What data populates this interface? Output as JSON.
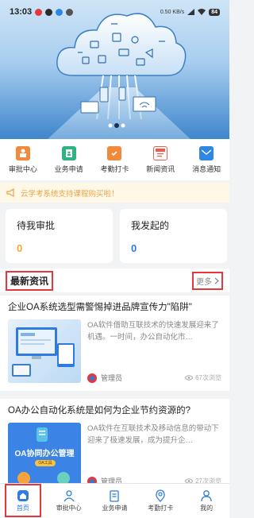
{
  "status_bar": {
    "time": "13:03",
    "network": "0.50 KB/s",
    "battery": "84"
  },
  "colors": {
    "accent": "#2f7be0",
    "highlight": "#e8373a",
    "notice": "#e7a64a",
    "count": "#f0a93a",
    "count2": "#2f7be0"
  },
  "quick_menu": [
    {
      "label": "审批中心",
      "icon": "stamp-icon",
      "color": "#f08a3c"
    },
    {
      "label": "业务申请",
      "icon": "clipboard-icon",
      "color": "#2fb383"
    },
    {
      "label": "考勤打卡",
      "icon": "calendar-check-icon",
      "color": "#f28a3c"
    },
    {
      "label": "新闻资讯",
      "icon": "news-icon",
      "color": "#ef5a4c"
    },
    {
      "label": "消息通知",
      "icon": "envelope-icon",
      "color": "#2f86e3"
    }
  ],
  "notice": {
    "text": "云学考系统支持课程购买啦！"
  },
  "cards": [
    {
      "title": "待我审批",
      "count": "0"
    },
    {
      "title": "我发起的",
      "count": "0"
    }
  ],
  "news": {
    "title": "最新资讯",
    "more": "更多",
    "items": [
      {
        "title": "企业OA系统选型需警惕掉进品牌宣传力\"陷阱\"",
        "summary": "OA软件借助互联技术的快速发展迎来了机遇。一时间，办公自动化市…",
        "author": "管理员",
        "views": "67次浏览"
      },
      {
        "title": "OA办公自动化系统是如何为企业节约资源的?",
        "summary": "OA软件在互联技术及移动信息的带动下迎来了极速发展，成为提升企…",
        "author": "管理员",
        "views": "27次浏览",
        "thumb_text": "OA协同办公管理",
        "thumb_badge": "OA工具"
      }
    ]
  },
  "bottom_nav": [
    {
      "label": "首页",
      "icon": "home-icon"
    },
    {
      "label": "审批中心",
      "icon": "user-icon"
    },
    {
      "label": "业务申请",
      "icon": "clipboard-icon"
    },
    {
      "label": "考勤打卡",
      "icon": "location-pin-icon"
    },
    {
      "label": "我的",
      "icon": "profile-icon"
    }
  ]
}
